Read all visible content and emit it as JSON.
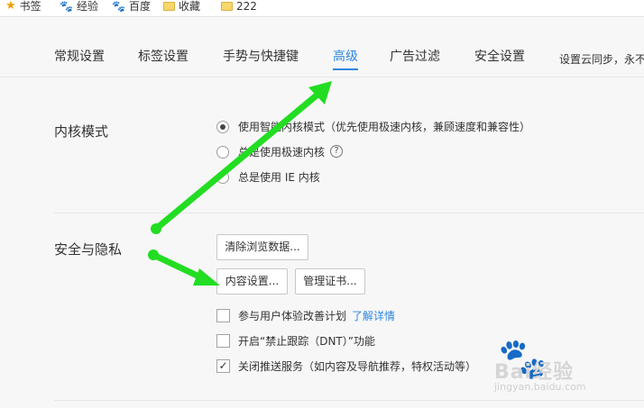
{
  "bookmarks": [
    {
      "label": "书签",
      "icon": "star-icon"
    },
    {
      "label": "经验",
      "icon": "paw-icon"
    },
    {
      "label": "百度",
      "icon": "paw-icon"
    },
    {
      "label": "收藏",
      "icon": "folder-icon"
    },
    {
      "label": "222",
      "icon": "folder-icon"
    }
  ],
  "tabs": [
    "常规设置",
    "标签设置",
    "手势与快捷键",
    "高级",
    "广告过滤",
    "安全设置"
  ],
  "active_tab": "高级",
  "cloud_sync_note": "设置云同步，永不",
  "kernel": {
    "title": "内核模式",
    "options": [
      "使用智能内核模式（优先使用极速内核，兼顾速度和兼容性）",
      "总是使用极速内核",
      "总是使用 IE 内核"
    ],
    "selected_index": 0
  },
  "privacy": {
    "title": "安全与隐私",
    "clear_button": "清除浏览数据...",
    "content_button": "内容设置...",
    "cert_button": "管理证书...",
    "checks": [
      {
        "label": "参与用户体验改善计划",
        "link": "了解详情",
        "checked": false
      },
      {
        "label": "开启“禁止跟踪（DNT）”功能",
        "checked": false
      },
      {
        "label": "关闭推送服务（如内容及导航推荐，特权活动等）",
        "checked": true
      }
    ]
  },
  "colors": {
    "accent": "#2f87e0",
    "arrow": "#22dd22"
  },
  "watermark": {
    "brand": "Bai经验",
    "url": "jingyan.baidu.com"
  }
}
